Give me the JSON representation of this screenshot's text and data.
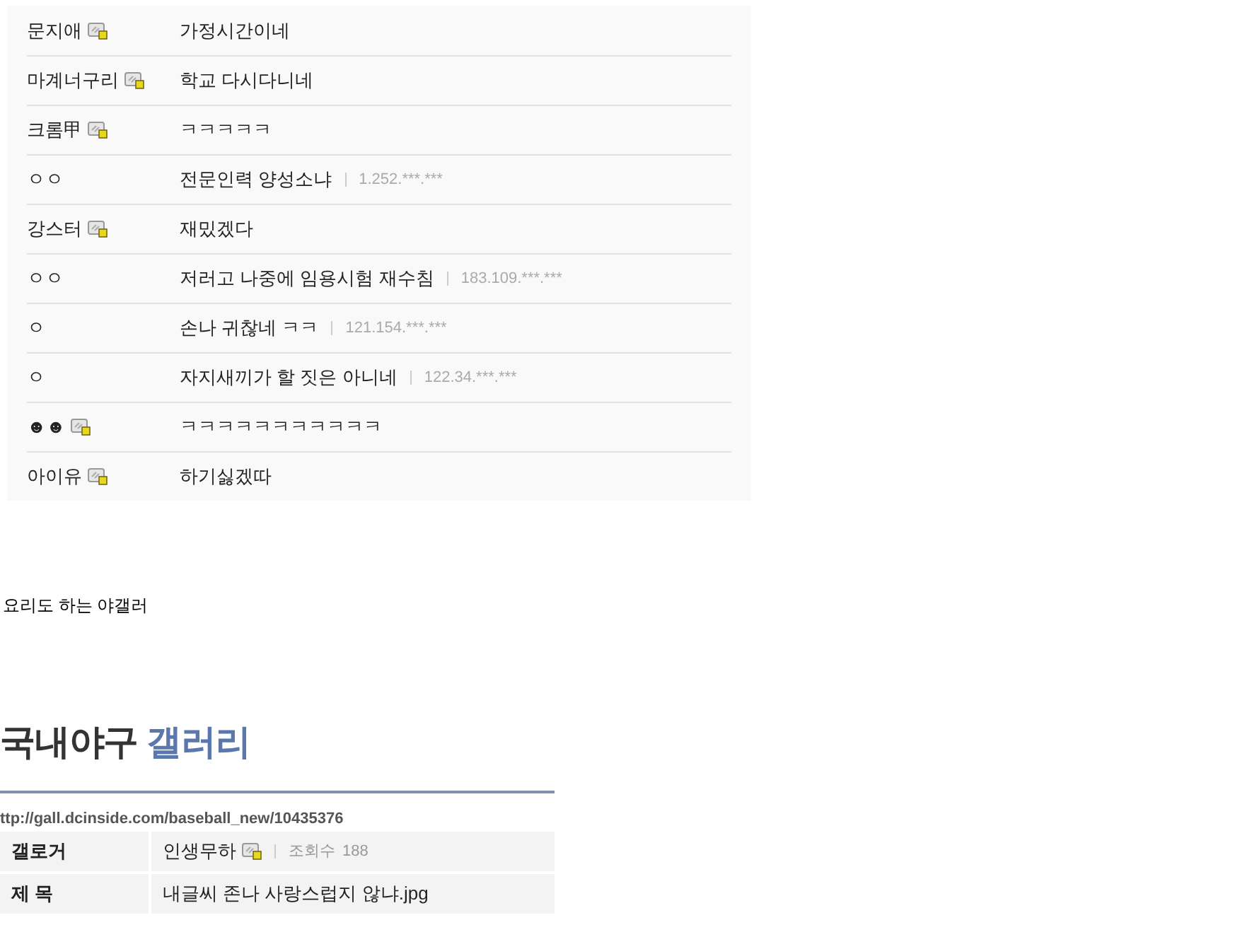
{
  "comments": [
    {
      "name": "문지애",
      "gallog_icon": true,
      "text": "가정시간이네"
    },
    {
      "name": "마계너구리",
      "gallog_icon": true,
      "text": "학교 다시다니네"
    },
    {
      "name": "크롬甲",
      "gallog_icon": true,
      "text": "ㅋㅋㅋㅋㅋ"
    },
    {
      "name": "ㅇㅇ",
      "gallog_icon": false,
      "text": "전문인력 양성소냐",
      "ip": "1.252.***.***"
    },
    {
      "name": "강스터",
      "gallog_icon": true,
      "text": "재밌겠다"
    },
    {
      "name": "ㅇㅇ",
      "gallog_icon": false,
      "text": "저러고 나중에 임용시험 재수침",
      "ip": "183.109.***.***"
    },
    {
      "name": "ㅇ",
      "gallog_icon": false,
      "text": "손나 귀찮네 ㅋㅋ",
      "ip": "121.154.***.***"
    },
    {
      "name": "ㅇ",
      "gallog_icon": false,
      "text": "자지새끼가 할 짓은 아니네",
      "ip": "122.34.***.***"
    },
    {
      "name": "☻☻",
      "gallog_icon": true,
      "text": "ㅋㅋㅋㅋㅋㅋㅋㅋㅋㅋㅋ"
    },
    {
      "name": "아이유",
      "gallog_icon": true,
      "text": "하기싫겠따"
    }
  ],
  "caption": "요리도 하는 야갤러",
  "gallery_title": {
    "main": "국내야구",
    "accent": "갤러리"
  },
  "url": "ttp://gall.dcinside.com/baseball_new/10435376",
  "post_info": [
    {
      "label": "갤로거",
      "value": "인생무하",
      "gallog_icon": true,
      "views_label": "조회수",
      "views": "188"
    },
    {
      "label": "제 목",
      "value": "내글씨 존나 사랑스럽지 않냐.jpg",
      "gallog_icon": false
    }
  ]
}
